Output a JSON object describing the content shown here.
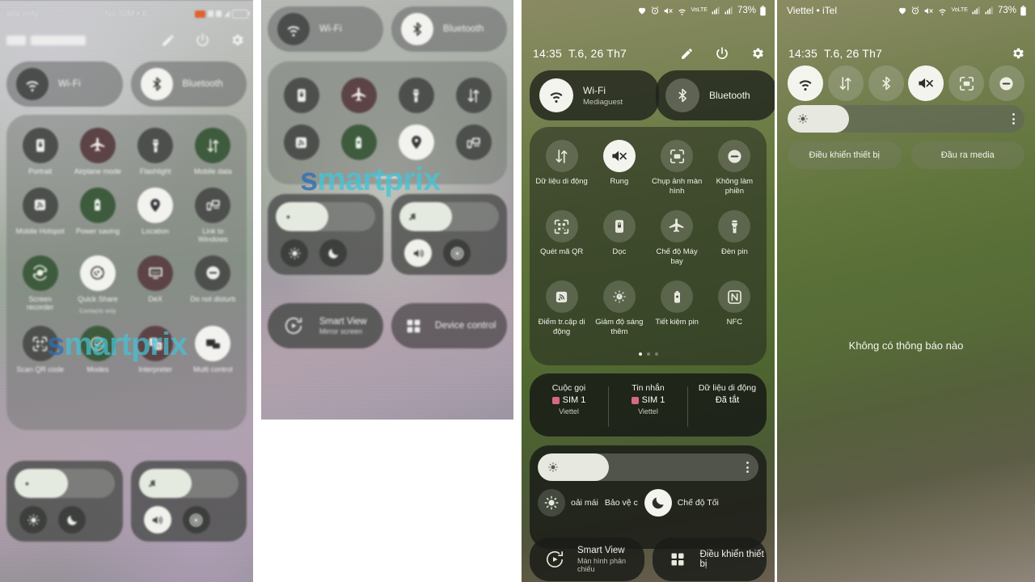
{
  "panel1": {
    "status": {
      "left": "alls only",
      "mid": "No SIM • E"
    },
    "header_icons": [
      "pencil-icon",
      "power-icon",
      "gear-icon"
    ],
    "pills": [
      {
        "label": "Wi-Fi",
        "icon": "wifi-icon",
        "state": "off"
      },
      {
        "label": "Bluetooth",
        "icon": "bluetooth-icon",
        "state": "on"
      }
    ],
    "tiles": [
      {
        "label": "Portrait",
        "icon": "portrait-lock-icon",
        "state": "off"
      },
      {
        "label": "Airplane mode",
        "icon": "airplane-icon",
        "state": "maroon"
      },
      {
        "label": "Flashlight",
        "icon": "flashlight-icon",
        "state": "off"
      },
      {
        "label": "Mobile data",
        "icon": "data-arrows-icon",
        "state": "green"
      },
      {
        "label": "Mobile Hotspot",
        "icon": "hotspot-icon",
        "state": "off"
      },
      {
        "label": "Power saving",
        "icon": "battery-leaf-icon",
        "state": "green"
      },
      {
        "label": "Location",
        "icon": "location-pin-icon",
        "state": "on"
      },
      {
        "label": "Link to Windows",
        "icon": "link-windows-icon",
        "state": "off"
      },
      {
        "label": "Screen recorder",
        "icon": "screen-record-icon",
        "state": "green"
      },
      {
        "label": "Quick Share",
        "sub": "Contacts only",
        "icon": "quick-share-icon",
        "state": "on"
      },
      {
        "label": "DeX",
        "icon": "dex-icon",
        "state": "maroon"
      },
      {
        "label": "Do not disturb",
        "icon": "dnd-icon",
        "state": "off"
      },
      {
        "label": "Scan QR code",
        "icon": "qr-scan-icon",
        "state": "off"
      },
      {
        "label": "Modes",
        "icon": "modes-check-icon",
        "state": "green"
      },
      {
        "label": "Interpreter",
        "icon": "interpreter-icon",
        "state": "maroon"
      },
      {
        "label": "Multi control",
        "icon": "multi-control-icon",
        "state": "on"
      }
    ],
    "brightness": {
      "icon": "brightness-icon",
      "value": 45,
      "sub_icons": [
        "brightness-auto-icon",
        "dark-mode-moon-icon"
      ]
    },
    "volume": {
      "icon": "music-note-icon",
      "value": 45,
      "sub_icons": [
        "speaker-icon",
        "sound-target-icon"
      ]
    },
    "watermark": "smartprix"
  },
  "panel2": {
    "pills": [
      {
        "label": "Wi-Fi",
        "icon": "wifi-icon",
        "state": "off"
      },
      {
        "label": "Bluetooth",
        "icon": "bluetooth-icon",
        "state": "on"
      }
    ],
    "tiles": [
      {
        "label": "",
        "icon": "portrait-lock-icon",
        "state": "off"
      },
      {
        "label": "",
        "icon": "airplane-icon",
        "state": "maroon"
      },
      {
        "label": "",
        "icon": "flashlight-icon",
        "state": "off"
      },
      {
        "label": "",
        "icon": "data-arrows-icon",
        "state": "off"
      },
      {
        "label": "",
        "icon": "hotspot-icon",
        "state": "off"
      },
      {
        "label": "",
        "icon": "battery-leaf-icon",
        "state": "green"
      },
      {
        "label": "",
        "icon": "location-pin-icon",
        "state": "on"
      },
      {
        "label": "",
        "icon": "link-windows-icon",
        "state": "off"
      }
    ],
    "brightness": {
      "icon": "brightness-icon",
      "value": 45,
      "sub_icons": [
        "brightness-auto-icon",
        "dark-mode-moon-icon"
      ]
    },
    "volume": {
      "icon": "music-note-icon",
      "value": 45,
      "sub_icons": [
        "speaker-icon",
        "sound-target-icon"
      ]
    },
    "bottom": [
      {
        "title": "Smart View",
        "sub": "Mirror screen",
        "icon": "smart-view-icon"
      },
      {
        "title": "Device control",
        "sub": "",
        "icon": "device-control-icon"
      }
    ],
    "watermark": "smartprix"
  },
  "panel3": {
    "status_icons": [
      "heart-icon",
      "alarm-icon",
      "mute-icon",
      "wifi-icon",
      "volte-icon",
      "signal-icon",
      "signal-icon"
    ],
    "battery_percent": "73%",
    "clock": "14:35",
    "date": "T.6, 26 Th7",
    "header_icons": [
      "pencil-icon",
      "power-icon",
      "gear-icon"
    ],
    "pills": [
      {
        "label": "Wi-Fi",
        "sub": "Mediaguest",
        "icon": "wifi-icon",
        "state": "on"
      },
      {
        "label": "Bluetooth",
        "sub": "",
        "icon": "bluetooth-icon",
        "state": "off"
      }
    ],
    "tiles": [
      {
        "label": "Dữ liệu di động",
        "icon": "data-arrows-icon",
        "state": "off"
      },
      {
        "label": "Rung",
        "icon": "vibrate-mute-icon",
        "state": "on"
      },
      {
        "label": "Chụp ảnh màn hình",
        "icon": "screenshot-icon",
        "state": "off"
      },
      {
        "label": "Không làm phiền",
        "icon": "dnd-icon",
        "state": "off"
      },
      {
        "label": "Quét mã QR",
        "icon": "qr-scan-icon",
        "state": "off"
      },
      {
        "label": "Dọc",
        "icon": "portrait-lock-icon",
        "state": "off"
      },
      {
        "label": "Chế độ Máy bay",
        "icon": "airplane-icon",
        "state": "off"
      },
      {
        "label": "Đèn pin",
        "icon": "flashlight-icon",
        "state": "off"
      },
      {
        "label": "Điểm tr.cập di động",
        "icon": "hotspot-icon",
        "state": "off"
      },
      {
        "label": "Giảm độ sáng thêm",
        "icon": "extra-dim-icon",
        "state": "off"
      },
      {
        "label": "Tiết kiệm pin",
        "icon": "battery-leaf-icon",
        "state": "off"
      },
      {
        "label": "NFC",
        "icon": "nfc-icon",
        "state": "off"
      }
    ],
    "page_dots": {
      "count": 3,
      "active": 0
    },
    "sim": [
      {
        "title": "Cuộc gọi",
        "value": "SIM 1",
        "sub": "Viettel"
      },
      {
        "title": "Tin nhắn",
        "value": "SIM 1",
        "sub": "Viettel"
      },
      {
        "title": "Dữ liệu di động",
        "value": "Đã tắt",
        "sub": ""
      }
    ],
    "brightness": {
      "icon": "brightness-icon",
      "value": 28
    },
    "modes": [
      {
        "label": "oải mái",
        "icon": "brightness-icon",
        "state": "off"
      },
      {
        "label": "Bảo vệ c",
        "icon": "",
        "state": "none"
      },
      {
        "label": "Chế độ Tối",
        "icon": "dark-mode-moon-icon",
        "state": "on"
      }
    ],
    "bottom": [
      {
        "title": "Smart View",
        "sub": "Màn hình phản chiếu",
        "icon": "smart-view-icon"
      },
      {
        "title": "Điều khiển thiết bị",
        "sub": "",
        "icon": "device-control-icon"
      }
    ]
  },
  "panel4": {
    "carrier": "Viettel • iTel",
    "status_icons": [
      "heart-icon",
      "alarm-icon",
      "mute-icon",
      "wifi-icon",
      "volte-icon",
      "signal-icon",
      "signal-icon"
    ],
    "battery_percent": "73%",
    "clock": "14:35",
    "date": "T.6, 26 Th7",
    "header_icons": [
      "gear-icon"
    ],
    "toggles": [
      {
        "icon": "wifi-icon",
        "state": "on"
      },
      {
        "icon": "data-arrows-icon",
        "state": "off"
      },
      {
        "icon": "bluetooth-icon",
        "state": "off"
      },
      {
        "icon": "vibrate-mute-icon",
        "state": "on"
      },
      {
        "icon": "screenshot-icon",
        "state": "off"
      },
      {
        "icon": "dnd-icon",
        "state": "off"
      }
    ],
    "brightness": {
      "icon": "brightness-icon",
      "value": 22
    },
    "chips": [
      "Điều khiển thiết bị",
      "Đầu ra media"
    ],
    "empty_text": "Không có thông báo nào"
  }
}
